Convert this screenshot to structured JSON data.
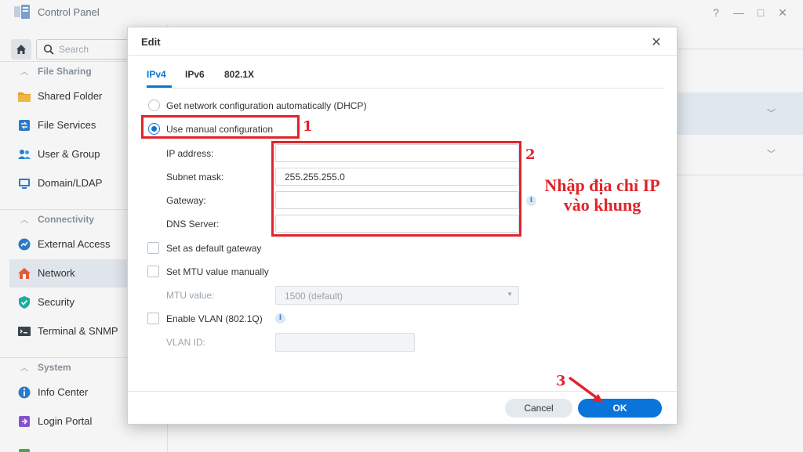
{
  "window": {
    "title": "Control Panel",
    "controls": {
      "help": "?",
      "minimize": "—",
      "maximize": "□",
      "close": "✕"
    }
  },
  "sidebar": {
    "search_placeholder": "Search",
    "sections": [
      {
        "title": "File Sharing",
        "items": [
          {
            "label": "Shared Folder",
            "icon": "folder-icon"
          },
          {
            "label": "File Services",
            "icon": "file-services-icon"
          },
          {
            "label": "User & Group",
            "icon": "users-icon"
          },
          {
            "label": "Domain/LDAP",
            "icon": "domain-icon"
          }
        ]
      },
      {
        "title": "Connectivity",
        "items": [
          {
            "label": "External Access",
            "icon": "external-access-icon"
          },
          {
            "label": "Network",
            "icon": "network-icon",
            "active": true
          },
          {
            "label": "Security",
            "icon": "shield-icon"
          },
          {
            "label": "Terminal & SNMP",
            "icon": "terminal-icon"
          }
        ]
      },
      {
        "title": "System",
        "items": [
          {
            "label": "Info Center",
            "icon": "info-icon"
          },
          {
            "label": "Login Portal",
            "icon": "login-portal-icon"
          }
        ]
      }
    ]
  },
  "dialog": {
    "title": "Edit",
    "tabs": [
      "IPv4",
      "IPv6",
      "802.1X"
    ],
    "active_tab": "IPv4",
    "options": {
      "dhcp": "Get network configuration automatically (DHCP)",
      "manual": "Use manual configuration"
    },
    "selected_option": "manual",
    "fields": {
      "ip_label": "IP address:",
      "ip_value": "",
      "subnet_label": "Subnet mask:",
      "subnet_value": "255.255.255.0",
      "gateway_label": "Gateway:",
      "gateway_value": "",
      "dns_label": "DNS Server:",
      "dns_value": ""
    },
    "checkboxes": {
      "default_gateway": "Set as default gateway",
      "mtu_manual": "Set MTU value manually",
      "vlan": "Enable VLAN (802.1Q)"
    },
    "mtu": {
      "label": "MTU value:",
      "value": "1500 (default)"
    },
    "vlan_id": {
      "label": "VLAN ID:",
      "value": ""
    },
    "buttons": {
      "cancel": "Cancel",
      "ok": "OK"
    }
  },
  "annotations": {
    "step1": "1",
    "step2": "2",
    "step3": "3",
    "note": "Nhập địa chỉ IP vào khung",
    "color": "#e0242a"
  },
  "colors": {
    "accent": "#0a74da",
    "sidebar_active": "#e9eff5"
  }
}
